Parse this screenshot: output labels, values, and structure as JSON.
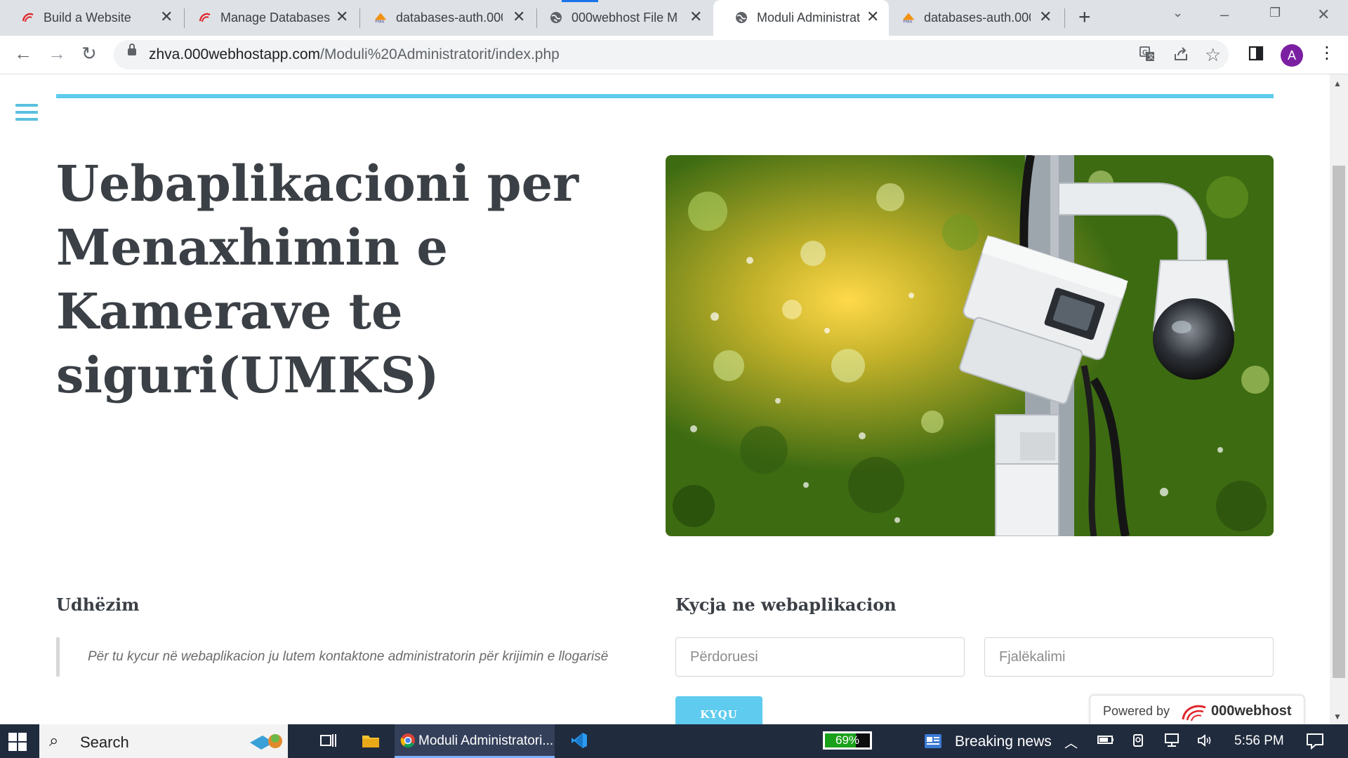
{
  "browser": {
    "tabs": [
      {
        "title": "Build a Website",
        "icon": "webhost-swirl-icon",
        "active": false
      },
      {
        "title": "Manage Databases",
        "icon": "webhost-swirl-icon",
        "active": false
      },
      {
        "title": "databases-auth.000",
        "icon": "phpmyadmin-icon",
        "active": false
      },
      {
        "title": "000webhost File M",
        "icon": "globe-icon",
        "active": false
      },
      {
        "title": "Moduli Administrat",
        "icon": "globe-icon",
        "active": true
      },
      {
        "title": "databases-auth.000",
        "icon": "phpmyadmin-icon",
        "active": false
      }
    ],
    "url_host": "zhva.000webhostapp.com",
    "url_path": "/Moduli%20Administratorit/index.php",
    "profile_initial": "A",
    "accent": "#1a73e8"
  },
  "page": {
    "hero_title": "Uebaplikacioni per Menaxhimin e Kamerave te siguri(UMKS)",
    "guide": {
      "heading": "Udhëzim",
      "text": "Për tu kycur në webaplikacion ju lutem kontaktone administratorin për krijimin e llogarisë"
    },
    "login": {
      "heading": "Kycja ne webaplikacion",
      "username_placeholder": "Përdoruesi",
      "password_placeholder": "Fjalëkalimi",
      "button_label": "KYQU"
    },
    "powered": {
      "label": "Powered by",
      "brand": "000webhost"
    },
    "accent": "#5fcbef"
  },
  "taskbar": {
    "search_label": "Search",
    "app_label": "Moduli Administratori...",
    "battery_percent": "69%",
    "battery_level": 0.69,
    "news_label": "Breaking news",
    "time": "5:56 PM"
  }
}
